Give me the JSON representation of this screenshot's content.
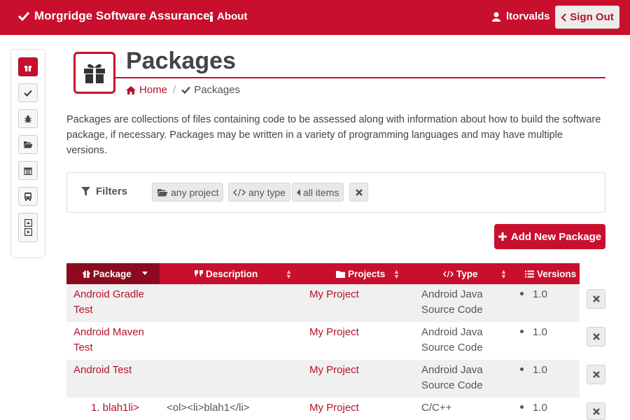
{
  "nav": {
    "brand": "Morgridge Software Assurance",
    "about": "About",
    "username": "ltorvalds",
    "signout": "Sign Out"
  },
  "page": {
    "title": "Packages",
    "breadcrumb_home": "Home",
    "breadcrumb_current": "Packages",
    "description": "Packages are collections of files containing code to be assessed along with information about how to build the software package, if necessary. Packages may be written in a variety of programming languages and may have multiple versions."
  },
  "filters": {
    "label": "Filters",
    "project": "any project",
    "type": "any type",
    "items": "all items"
  },
  "add_button": "Add New Package",
  "table": {
    "headers": {
      "package": "Package",
      "description": "Description",
      "projects": "Projects",
      "type": "Type",
      "versions": "Versions"
    },
    "rows": [
      {
        "package1": "Android Gradle",
        "package2": "Test",
        "description": "",
        "project": "My Project",
        "type1": "Android Java",
        "type2": "Source Code",
        "version": "1.0"
      },
      {
        "package1": "Android Maven",
        "package2": "Test",
        "description": "",
        "project": "My Project",
        "type1": "Android Java",
        "type2": "Source Code",
        "version": "1.0"
      },
      {
        "package1": "Android Test",
        "package2": "",
        "description": "",
        "project": "My Project",
        "type1": "Android Java",
        "type2": "Source Code",
        "version": "1.0"
      },
      {
        "package1": "1. blah1li>",
        "package2": "",
        "description": "<ol><li>blah1</li>",
        "project": "My Project",
        "type1": "C/C++",
        "type2": "",
        "version": "1.0"
      }
    ]
  },
  "colors": {
    "brand_red": "#c8102e",
    "dark_red": "#8c0a1f",
    "row_alt": "#f0f0f0"
  }
}
